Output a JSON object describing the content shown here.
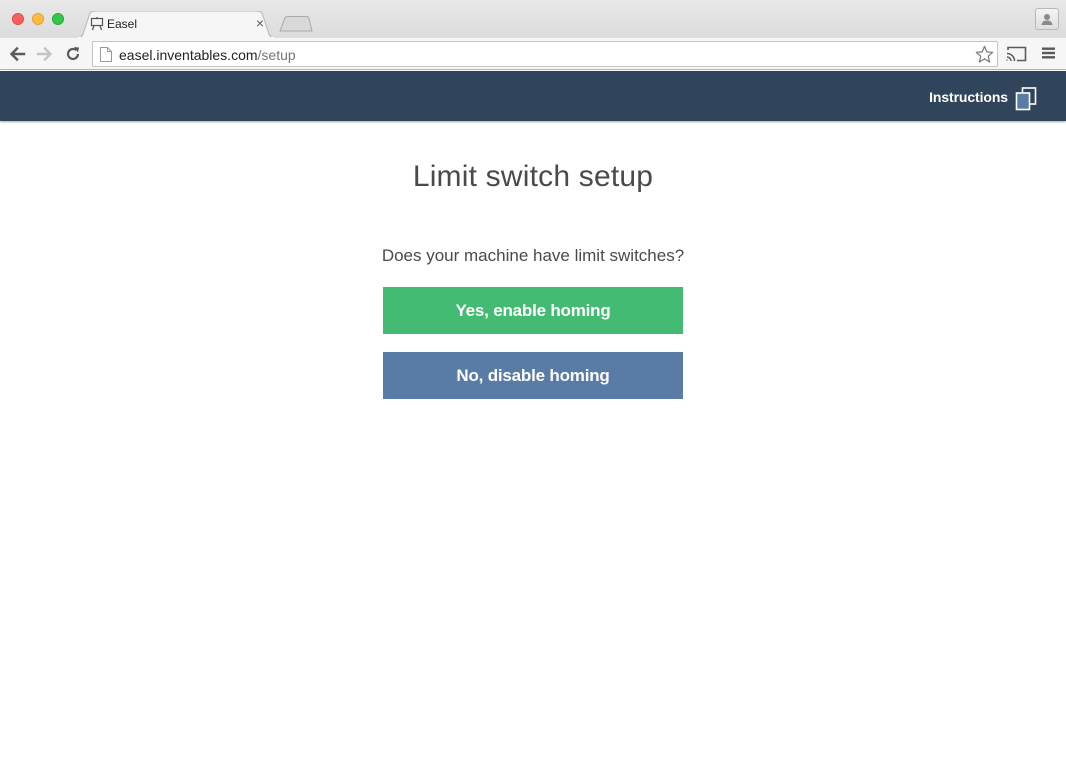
{
  "browser": {
    "tab": {
      "title": "Easel",
      "favicon": "easel-icon",
      "close_glyph": "×"
    },
    "address_bar": {
      "domain": "easel.inventables.com",
      "path": "/setup"
    },
    "icons": {
      "back": "arrow-left-icon",
      "forward": "arrow-right-icon",
      "reload": "reload-icon",
      "bookmark": "star-icon",
      "cast": "cast-icon",
      "menu": "hamburger-menu-icon",
      "profile": "person-icon"
    }
  },
  "header": {
    "instructions_label": "Instructions",
    "instructions_icon": "documents-icon",
    "background_color": "#30455b"
  },
  "main": {
    "title": "Limit switch setup",
    "question": "Does your machine have limit switches?",
    "yes_button": {
      "label": "Yes, enable homing",
      "color": "#43bb72"
    },
    "no_button": {
      "label": "No, disable homing",
      "color": "#587ca6"
    }
  }
}
